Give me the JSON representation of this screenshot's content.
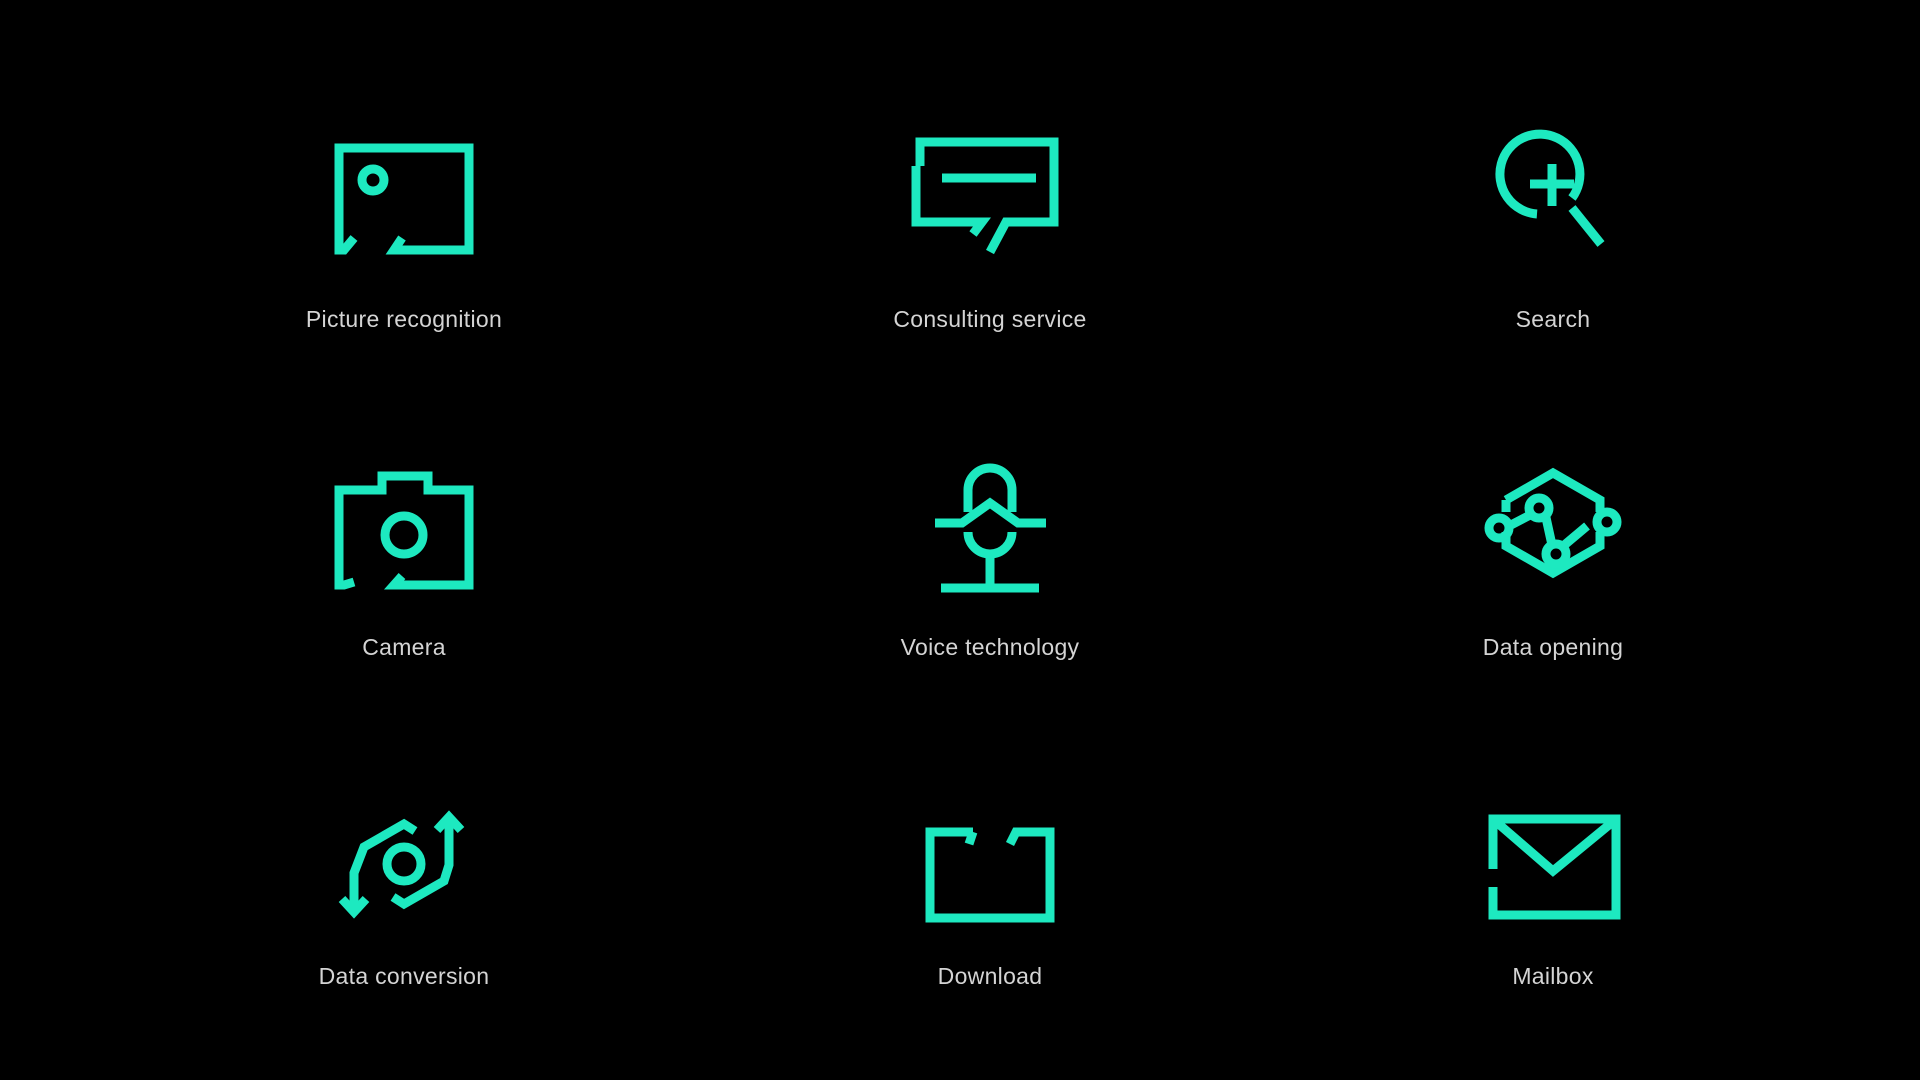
{
  "accent_color": "#1de9c0",
  "label_color": "#d4d4d4",
  "background_color": "#000000",
  "icons": [
    {
      "icon": "picture-recognition-icon",
      "label": "Picture recognition"
    },
    {
      "icon": "consulting-service-icon",
      "label": "Consulting service"
    },
    {
      "icon": "search-icon",
      "label": "Search"
    },
    {
      "icon": "camera-icon",
      "label": "Camera"
    },
    {
      "icon": "voice-technology-icon",
      "label": "Voice technology"
    },
    {
      "icon": "data-opening-icon",
      "label": "Data opening"
    },
    {
      "icon": "data-conversion-icon",
      "label": "Data conversion"
    },
    {
      "icon": "download-icon",
      "label": "Download"
    },
    {
      "icon": "mailbox-icon",
      "label": "Mailbox"
    }
  ]
}
